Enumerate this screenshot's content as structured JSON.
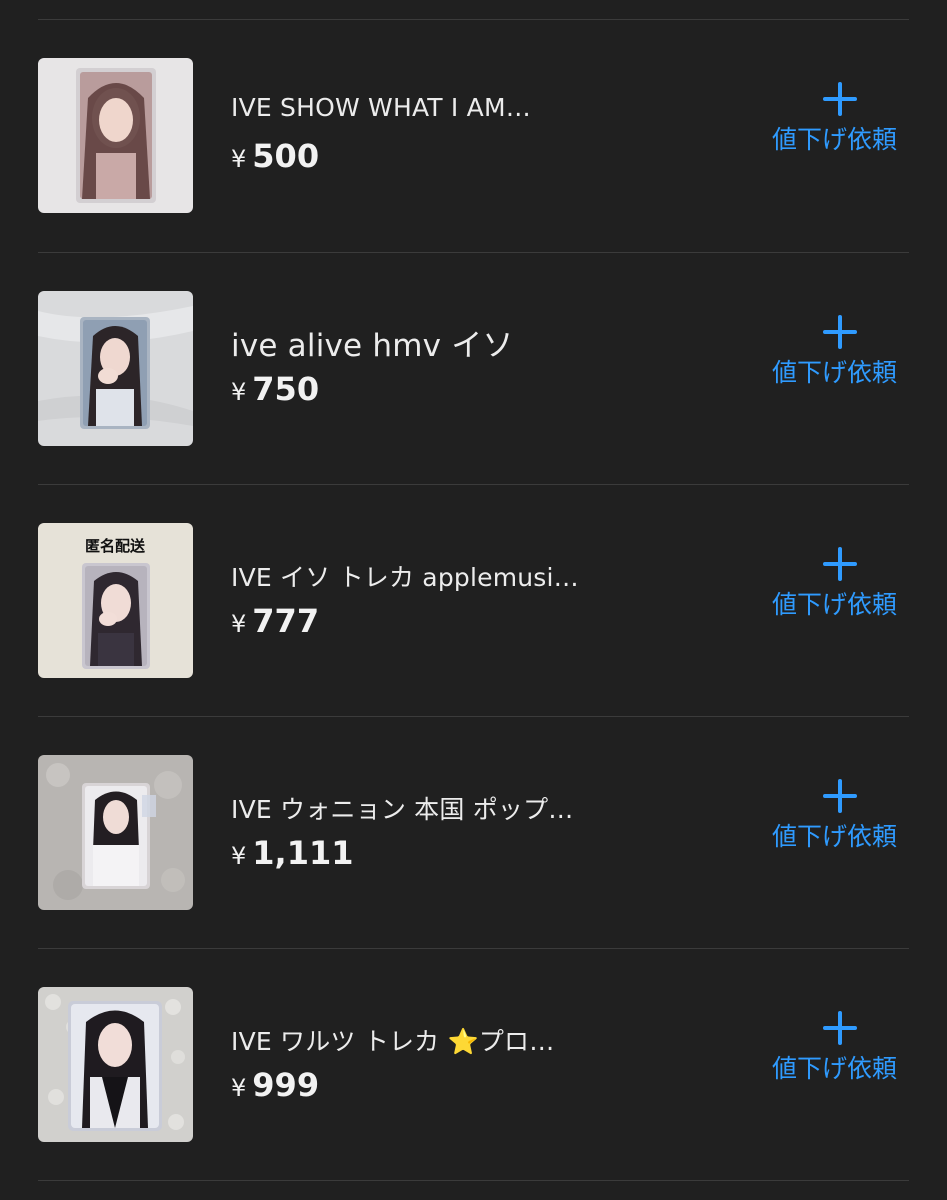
{
  "listings": [
    {
      "title": "IVE SHOW WHAT I AM…",
      "price": "500",
      "currency": "¥",
      "thumbnail_icon": "photocard-image-icon",
      "badge": ""
    },
    {
      "title": "ive alive hmv イソ",
      "price": "750",
      "currency": "¥",
      "thumbnail_icon": "photocard-image-icon",
      "badge": ""
    },
    {
      "title": "IVE イソ トレカ applemusi…",
      "price": "777",
      "currency": "¥",
      "thumbnail_icon": "photocard-image-icon",
      "badge": "匿名配送"
    },
    {
      "title": "IVE ウォニョン 本国 ポップ…",
      "price": "1,111",
      "currency": "¥",
      "thumbnail_icon": "photocard-image-icon",
      "badge": ""
    },
    {
      "title": "IVE ワルツ トレカ ⭐️プロ…",
      "price": "999",
      "currency": "¥",
      "thumbnail_icon": "photocard-image-icon",
      "badge": ""
    }
  ],
  "actions": {
    "price_request_label": "値下げ依頼",
    "price_request_icon": "plus-icon"
  },
  "colors": {
    "background": "#202020",
    "accent": "#2f9bff",
    "divider": "#3b3b3b",
    "text": "#ececec"
  }
}
